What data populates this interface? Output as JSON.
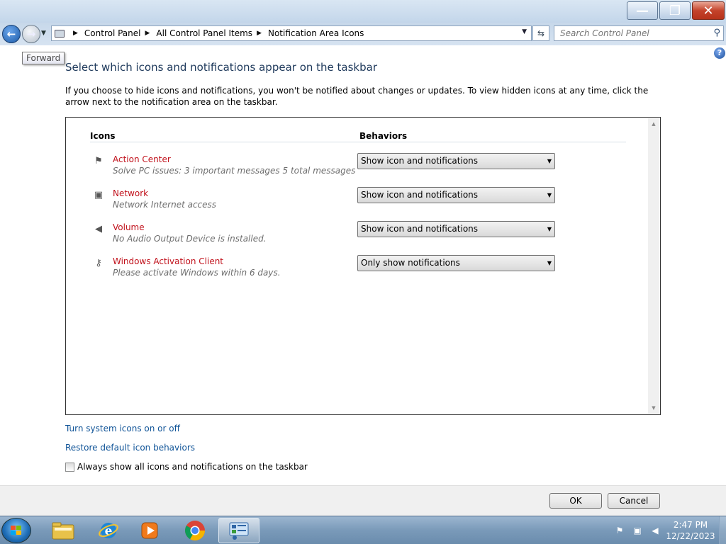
{
  "titlebar": {
    "min_label": "—",
    "max_label": "❐",
    "close_label": "✕"
  },
  "nav": {
    "back_icon": "back-arrow-icon",
    "forward_icon": "forward-arrow-icon",
    "breadcrumbs": [
      "Control Panel",
      "All Control Panel Items",
      "Notification Area Icons"
    ]
  },
  "search": {
    "placeholder": "Search Control Panel"
  },
  "tooltip": "Forward",
  "heading": "Select which icons and notifications appear on the taskbar",
  "description": "If you choose to hide icons and notifications, you won't be notified about changes or updates. To view hidden icons at any time, click the arrow next to the notification area on the taskbar.",
  "table": {
    "col_icons": "Icons",
    "col_behaviors": "Behaviors",
    "rows": [
      {
        "name": "Action Center",
        "desc": "Solve PC issues: 3 important messages  5 total messages",
        "behavior": "Show icon and notifications",
        "icon": "action-center-flag-icon"
      },
      {
        "name": "Network",
        "desc": "Network Internet access",
        "behavior": "Show icon and notifications",
        "icon": "network-icon"
      },
      {
        "name": "Volume",
        "desc": "No Audio Output Device is installed.",
        "behavior": "Show icon and notifications",
        "icon": "volume-icon"
      },
      {
        "name": "Windows Activation Client",
        "desc": "Please activate Windows within 6 days.",
        "behavior": "Only show notifications",
        "icon": "activation-key-icon"
      }
    ]
  },
  "links": {
    "system_icons": "Turn system icons on or off",
    "restore": "Restore default icon behaviors"
  },
  "checkbox": {
    "label": "Always show all icons and notifications on the taskbar",
    "checked": false
  },
  "buttons": {
    "ok": "OK",
    "cancel": "Cancel"
  },
  "taskbar": {
    "apps": [
      "Windows Explorer",
      "Internet Explorer",
      "Windows Media Player",
      "Google Chrome",
      "Control Panel"
    ],
    "time": "2:47 PM",
    "date": "12/22/2023"
  },
  "colors": {
    "heading": "#1e395b",
    "link": "#0f5397",
    "item_name": "#c1121c",
    "taskbar": "#7a9ab9"
  }
}
